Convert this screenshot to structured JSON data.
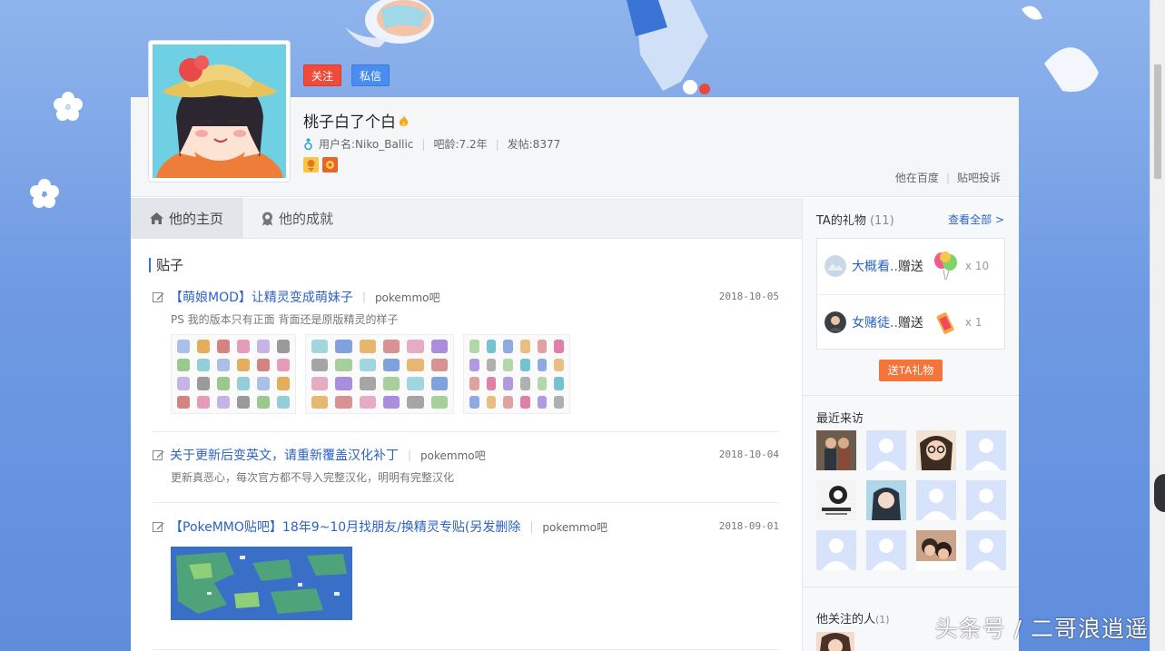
{
  "profile": {
    "follow_label": "关注",
    "message_label": "私信",
    "display_name": "桃子白了个白",
    "username_label": "用户名:Niko_Ballic",
    "bar_age_label": "吧龄:7.2年",
    "post_count_label": "发帖:8377",
    "links": [
      "他在百度",
      "贴吧投诉"
    ]
  },
  "tabs": [
    {
      "label": "他的主页",
      "active": true
    },
    {
      "label": "他的成就",
      "active": false
    }
  ],
  "posts_section": {
    "title": "贴子",
    "posts": [
      {
        "title": "【萌娘MOD】让精灵变成萌妹子",
        "bar": "pokemmo吧",
        "date": "2018-10-05",
        "abstract": "PS 我的版本只有正面 背面还是原版精灵的样子"
      },
      {
        "title": "关于更新后变英文，请重新覆盖汉化补丁",
        "bar": "pokemmo吧",
        "date": "2018-10-04",
        "abstract": "更新真恶心，每次官方都不导入完整汉化，明明有完整汉化"
      },
      {
        "title": "【PokeMMO贴吧】18年9~10月找朋友/换精灵专贴(另发删除",
        "bar": "pokemmo吧",
        "date": "2018-09-01",
        "abstract": ""
      }
    ]
  },
  "sidebar": {
    "gifts_title": "TA的礼物",
    "gifts_count": "(11)",
    "view_all": "查看全部 >",
    "gifts": [
      {
        "user": "大概看..",
        "verb": "赠送",
        "count": "x 10",
        "icon": "balloons-icon"
      },
      {
        "user": "女赌徒..",
        "verb": "赠送",
        "count": "x 1",
        "icon": "lipstick-icon"
      }
    ],
    "send_gift_label": "送TA礼物",
    "visitors_title": "最近来访",
    "following_title": "他关注的人",
    "following_count": "(1)"
  },
  "watermark": "头条号 / 二哥浪逍遥",
  "colors": {
    "accent_blue": "#2a63c4",
    "follow_red": "#f04a3a",
    "message_blue": "#4a8df0",
    "gift_orange": "#f3753a"
  }
}
